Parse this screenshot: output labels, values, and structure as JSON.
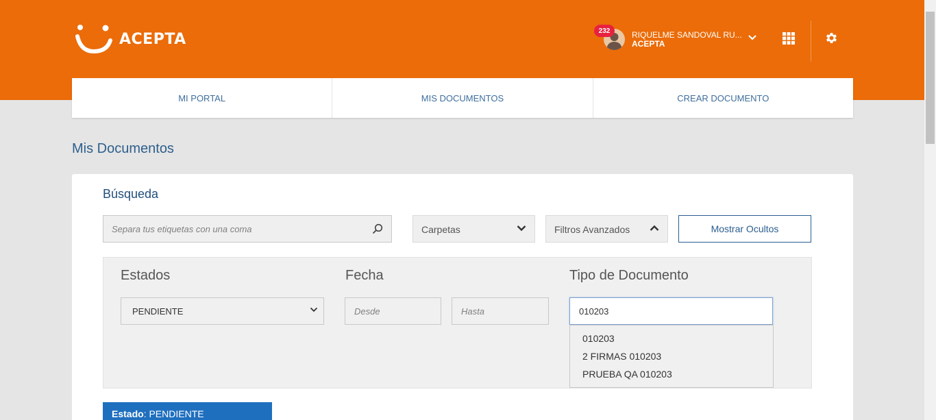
{
  "header": {
    "brand": "ACEPTA",
    "user": {
      "name": "RIQUELME SANDOVAL RU...",
      "org": "ACEPTA",
      "notification_count": "232"
    },
    "icons": [
      "user-avatar-icon",
      "chevron-down-icon",
      "apps-grid-icon",
      "gear-icon"
    ],
    "colors": {
      "header_bg": "#eb6c09",
      "badge": "#e8213f"
    }
  },
  "nav": {
    "tabs": [
      {
        "label": "MI PORTAL"
      },
      {
        "label": "MIS DOCUMENTOS"
      },
      {
        "label": "CREAR DOCUMENTO"
      }
    ]
  },
  "page": {
    "title": "Mis Documentos"
  },
  "search": {
    "title": "Búsqueda",
    "tags_placeholder": "Separa tus etiquetas con una coma",
    "carpetas_label": "Carpetas",
    "filtros_label": "Filtros Avanzados",
    "show_hidden_label": "Mostrar Ocultos"
  },
  "filters": {
    "estados_label": "Estados",
    "estados_value": "PENDIENTE",
    "fecha_label": "Fecha",
    "desde_placeholder": "Desde",
    "hasta_placeholder": "Hasta",
    "tipo_label": "Tipo de Documento",
    "tipo_value": "010203",
    "tipo_suggestions": [
      "010203",
      "2 FIRMAS 010203",
      "PRUEBA QA 010203"
    ]
  },
  "state_banner": {
    "label": "Estado",
    "value": "PENDIENTE"
  }
}
